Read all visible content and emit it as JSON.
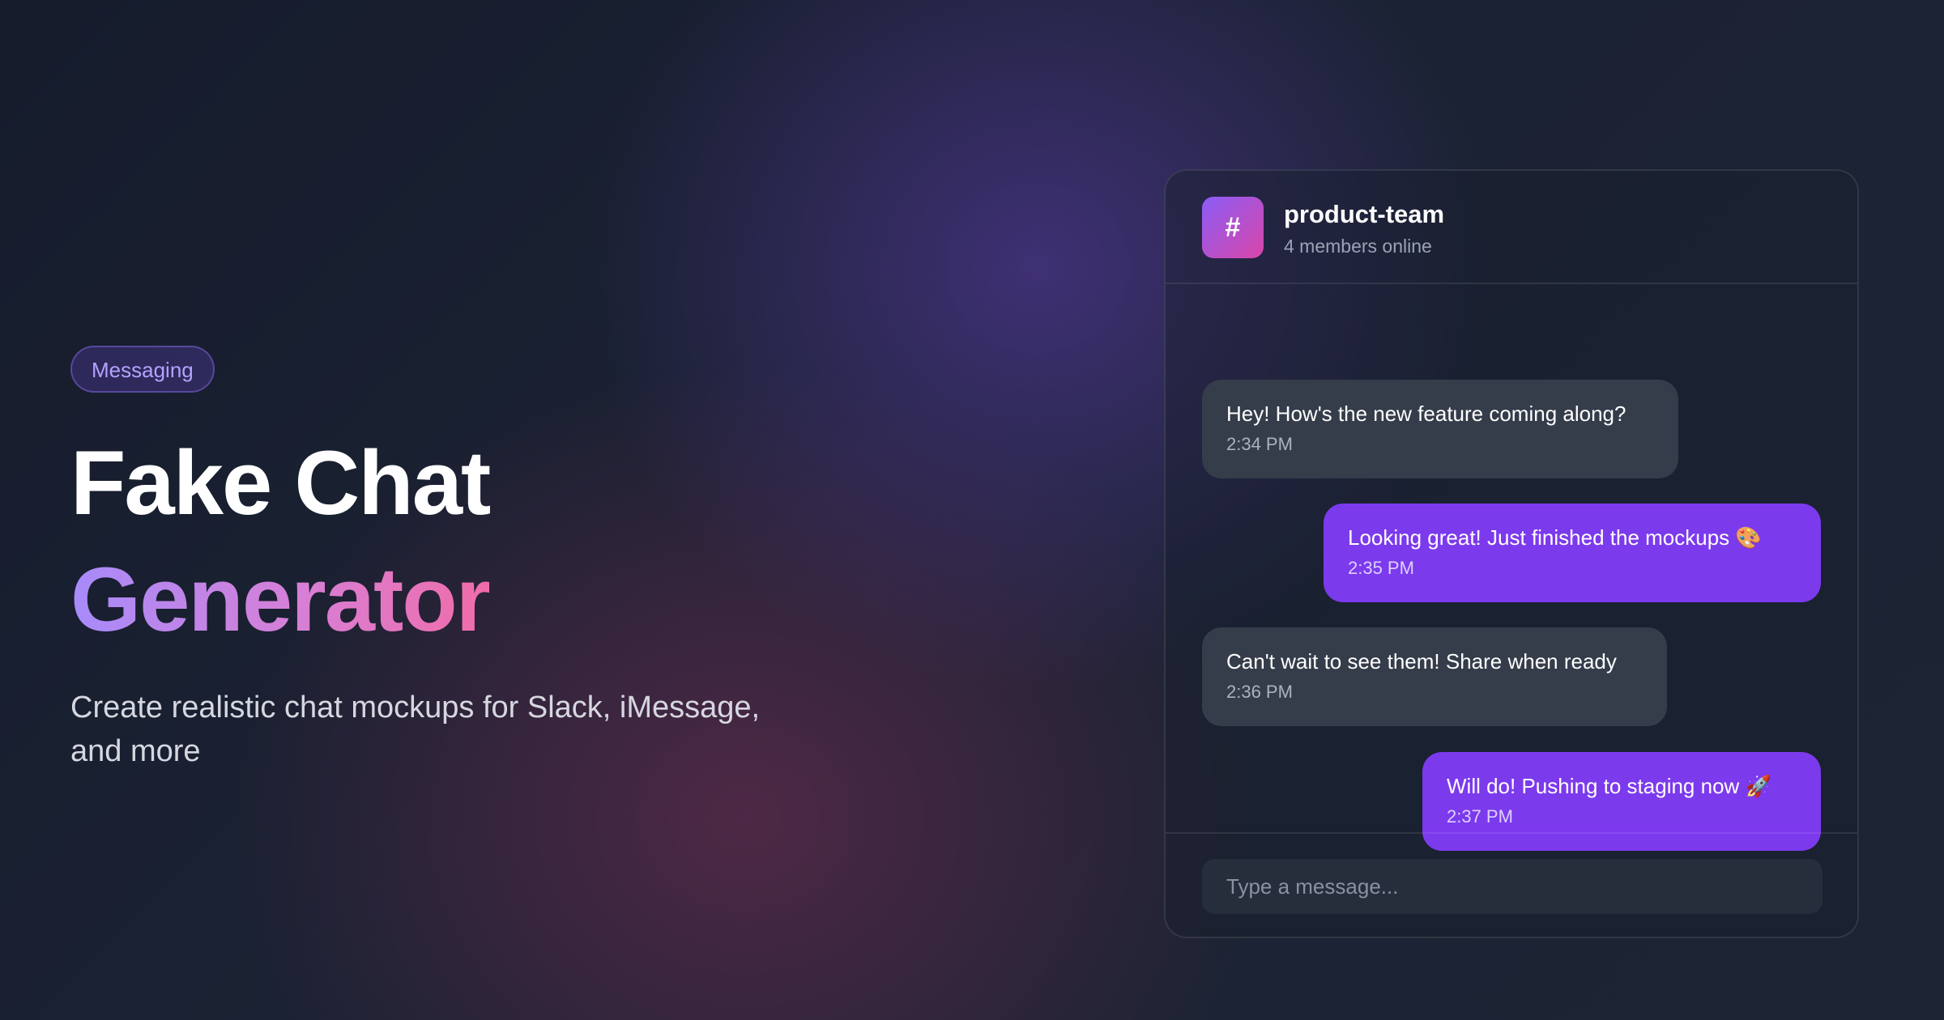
{
  "hero": {
    "badge": "Messaging",
    "title_line1": "Fake Chat",
    "title_line2": "Generator",
    "subtitle": "Create realistic chat mockups for Slack, iMessage, and more"
  },
  "chat": {
    "channel_icon": "#",
    "channel_name": "product-team",
    "channel_status": "4 members online",
    "messages": [
      {
        "direction": "incoming",
        "text": "Hey! How's the new feature coming along?",
        "time": "2:34 PM"
      },
      {
        "direction": "outgoing",
        "text": "Looking great! Just finished the mockups 🎨",
        "time": "2:35 PM"
      },
      {
        "direction": "incoming",
        "text": "Can't wait to see them! Share when ready",
        "time": "2:36 PM"
      },
      {
        "direction": "outgoing",
        "text": "Will do! Pushing to staging now 🚀",
        "time": "2:37 PM"
      }
    ],
    "input_placeholder": "Type a message..."
  },
  "colors": {
    "background": "#1b2233",
    "accent_purple": "#7c3aed",
    "incoming_bubble": "#353c4a",
    "title_gradient_start": "#a78bfa",
    "title_gradient_end": "#f16ca8",
    "channel_icon_gradient_start": "#8b5cf6",
    "channel_icon_gradient_end": "#d946a8"
  }
}
